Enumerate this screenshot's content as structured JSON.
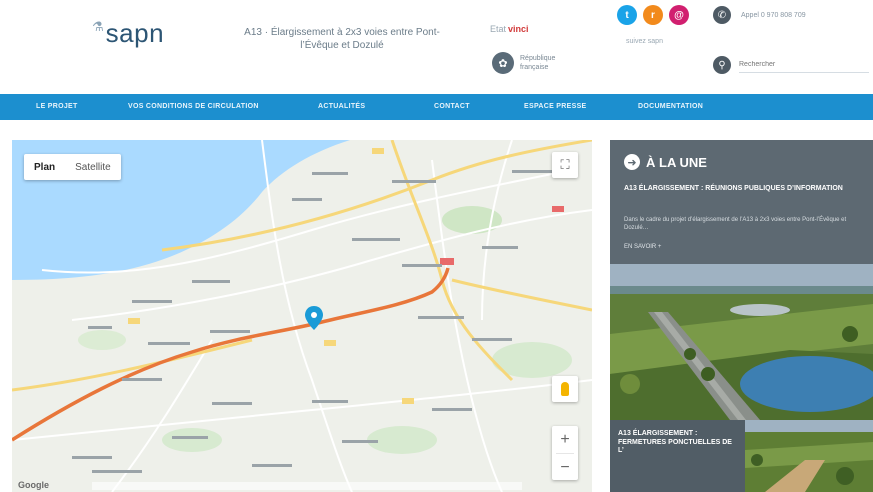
{
  "header": {
    "logo_text": "sapn",
    "logo_mark": "⚗",
    "tagline": "A13 · Élargissement à 2x3 voies entre Pont-l’Évêque et Dozulé",
    "partner1_prefix": "Etat",
    "partner1_name": "vinci",
    "partner2_icon": "leaf-icon",
    "partner2_text": "République française",
    "social_caption": "suivez sapn",
    "phone_text": "Appel 0 970 808 709",
    "search_placeholder": "Rechercher"
  },
  "nav": {
    "items": [
      "LE PROJET",
      "VOS CONDITIONS DE CIRCULATION",
      "ACTUALITÉS",
      "CONTACT",
      "ESPACE PRESSE",
      "DOCUMENTATION"
    ]
  },
  "map": {
    "type_plan": "Plan",
    "type_satellite": "Satellite",
    "brand": "Google",
    "zoom_in": "+",
    "zoom_out": "−",
    "fullscreen_symbol": "⛶",
    "sea_color": "#aadaff",
    "route_color": "#e8763a",
    "marker_color": "#1a9bd7"
  },
  "panel": {
    "section_title": "À LA UNE",
    "headline": "A13 ÉLARGISSEMENT : RÉUNIONS PUBLIQUES D’INFORMATION",
    "description": "Dans le cadre du projet d’élargissement de l’A13 à 2x3 voies entre Pont-l’Évêque et Dozulé…",
    "more_link": "EN SAVOIR +",
    "caption": "A13 ÉLARGISSEMENT : FERMETURES PONCTUELLES DE L’"
  }
}
